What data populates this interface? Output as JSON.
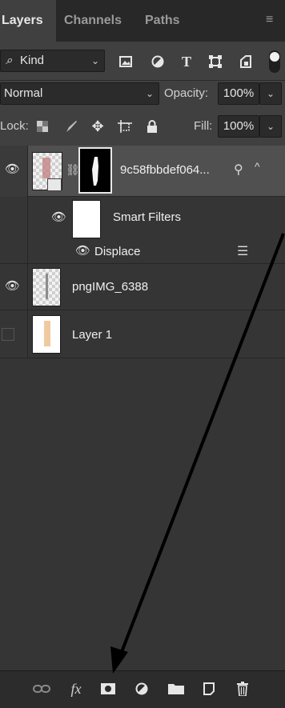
{
  "tabs": [
    "Layers",
    "Channels",
    "Paths"
  ],
  "filter": {
    "label": "Kind"
  },
  "blend": {
    "mode": "Normal",
    "opacity_label": "Opacity:",
    "opacity_value": "100%"
  },
  "lock": {
    "label": "Lock:",
    "fill_label": "Fill:",
    "fill_value": "100%"
  },
  "layers": [
    {
      "name": "9c58fbbdef064..."
    },
    {
      "name": "Smart Filters"
    },
    {
      "name": "Displace"
    },
    {
      "name": "pngIMG_6388"
    },
    {
      "name": "Layer 1"
    }
  ],
  "bottom_icons": [
    "link-icon",
    "fx-icon",
    "mask-icon",
    "adjustment-icon",
    "folder-icon",
    "new-layer-icon",
    "trash-icon"
  ],
  "bottom_fx_label": "fx",
  "colors": {
    "panel": "#353535",
    "tab_active": "#404040",
    "tab_bar": "#282828"
  }
}
